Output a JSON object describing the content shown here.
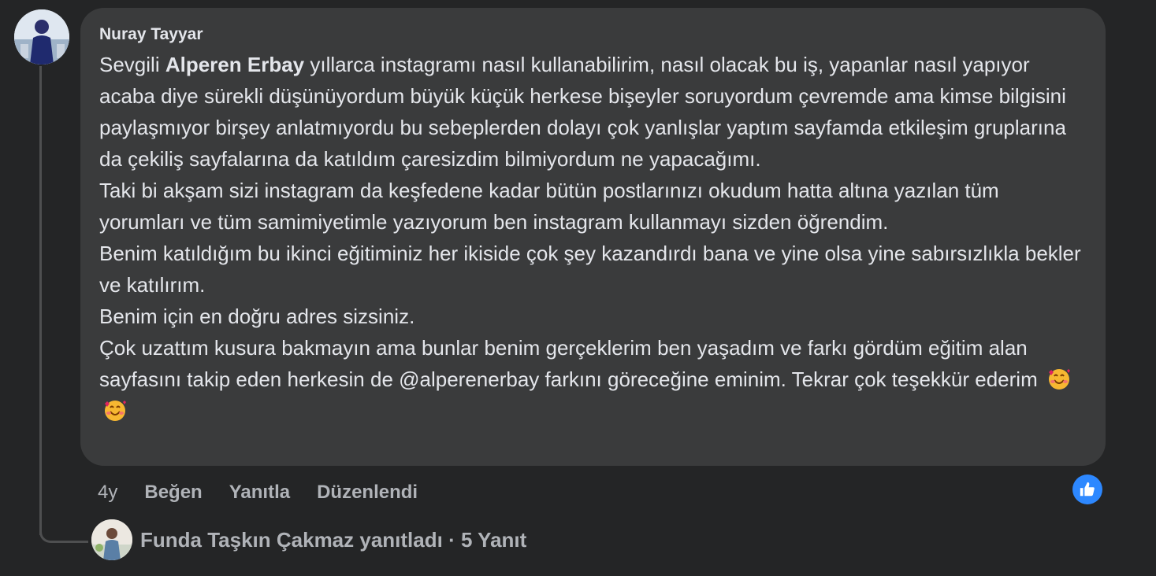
{
  "comment": {
    "author": "Nuray Tayyar",
    "text_prefix": "Sevgili ",
    "mention": "Alperen Erbay",
    "text_body": " yıllarca instagramı nasıl kullanabilirim, nasıl olacak bu iş, yapanlar nasıl yapıyor acaba diye sürekli düşünüyordum büyük küçük herkese bişeyler soruyordum çevremde ama kimse bilgisini paylaşmıyor birşey anlatmıyordu bu sebeplerden dolayı çok yanlışlar yaptım sayfamda etkileşim gruplarına da çekiliş sayfalarına da katıldım çaresizdim bilmiyordum ne yapacağımı.\nTaki bi akşam sizi instagram da keşfedene kadar bütün postlarınızı okudum hatta altına yazılan tüm yorumları ve tüm samimiyetimle yazıyorum ben instagram kullanmayı sizden öğrendim.\nBenim katıldığım bu ikinci eğitiminiz her ikiside çok şey kazandırdı bana ve yine olsa yine sabırsızlıkla bekler ve katılırım.\nBenim için en doğru adres sizsiniz.\nÇok uzattım kusura bakmayın ama bunlar benim gerçeklerim ben yaşadım ve farkı gördüm eğitim alan sayfasını takip eden herkesin de @alperenerbay farkını göreceğine eminim. Tekrar çok teşekkür ederim",
    "emojis": [
      "smiling-face-with-hearts-icon",
      "smiling-face-with-hearts-icon"
    ]
  },
  "actions": {
    "age": "4y",
    "like": "Beğen",
    "reply": "Yanıtla",
    "edited": "Düzenlendi"
  },
  "reaction": {
    "icon": "thumbs-up-icon",
    "color": "#2d88ff"
  },
  "replies": {
    "text": "Funda Taşkın Çakmaz yanıtladı · 5 Yanıt"
  },
  "colors": {
    "background": "#242526",
    "bubble": "#3a3b3c",
    "text": "#e4e6eb",
    "muted": "#b0b3b8"
  }
}
